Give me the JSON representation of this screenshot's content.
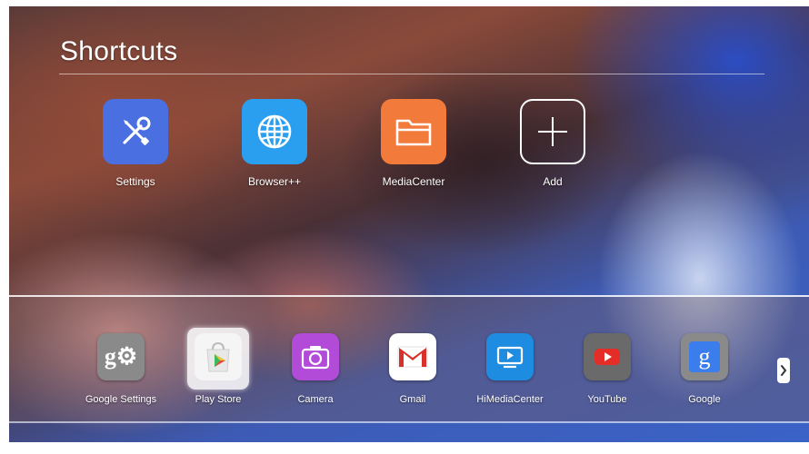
{
  "header": {
    "title": "Shortcuts"
  },
  "shortcuts": [
    {
      "label": "Settings",
      "icon": "settings-tools-icon",
      "color": "#4a6fe0"
    },
    {
      "label": "Browser++",
      "icon": "globe-icon",
      "color": "#2a9ff0"
    },
    {
      "label": "MediaCenter",
      "icon": "folder-icon",
      "color": "#f27a3a"
    },
    {
      "label": "Add",
      "icon": "plus-icon",
      "color": "transparent"
    }
  ],
  "dock": {
    "apps": [
      {
        "label": "Google Settings",
        "icon": "google-settings-icon",
        "glyph": "g⚙"
      },
      {
        "label": "Play Store",
        "icon": "play-store-icon",
        "glyph": ""
      },
      {
        "label": "Camera",
        "icon": "camera-icon",
        "glyph": ""
      },
      {
        "label": "Gmail",
        "icon": "gmail-icon",
        "glyph": ""
      },
      {
        "label": "HiMediaCenter",
        "icon": "himediacenter-icon",
        "glyph": ""
      },
      {
        "label": "YouTube",
        "icon": "youtube-icon",
        "glyph": ""
      },
      {
        "label": "Google",
        "icon": "google-search-icon",
        "glyph": "g"
      }
    ],
    "selected": "Play Store",
    "next_icon": "chevron-right-icon"
  }
}
